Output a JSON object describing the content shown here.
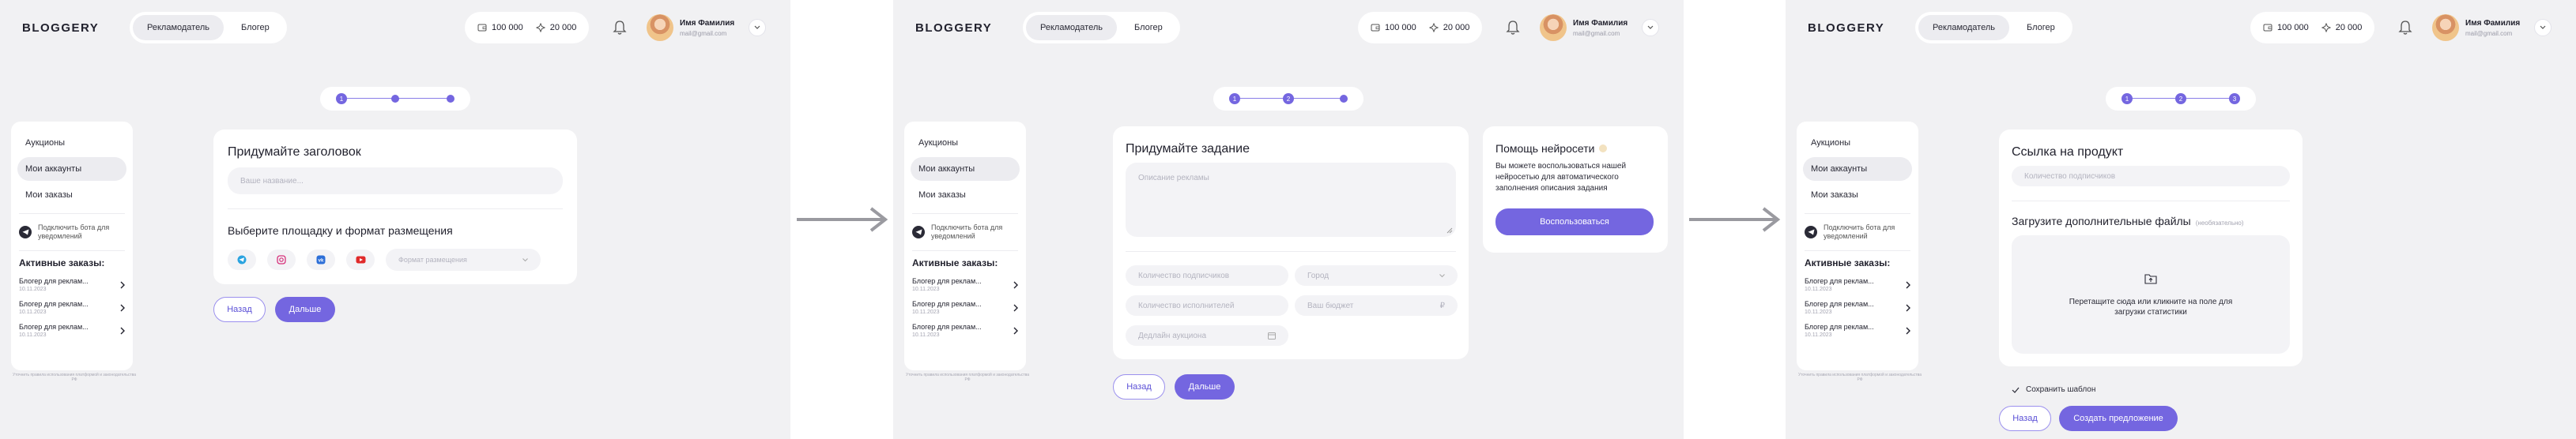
{
  "header": {
    "logo": "BLOGGERY",
    "roles": [
      "Рекламодатель",
      "Блогер"
    ],
    "balance_1": "100 000",
    "balance_2": "20 000",
    "user_name": "Имя Фамилия",
    "user_email": "mail@gmail.com"
  },
  "stepper": {
    "labels": [
      "1",
      "2",
      "3"
    ]
  },
  "sidebar": {
    "items": [
      "Аукционы",
      "Мои аккаунты",
      "Мои заказы"
    ],
    "telegram": "Подключить бота для уведомлений",
    "orders_title": "Активные заказы:",
    "orders": [
      {
        "name": "Блогер для реклам...",
        "date": "10.11.2023"
      },
      {
        "name": "Блогер для реклам...",
        "date": "10.11.2023"
      },
      {
        "name": "Блогер для реклам...",
        "date": "10.11.2023"
      }
    ],
    "legal": "Уточнить правила использования платформой и законодательства РФ"
  },
  "step1": {
    "title": "Придумайте заголовок",
    "title_placeholder": "Ваше название...",
    "platform_title": "Выберите площадку и формат размещения",
    "format_placeholder": "Формат размещения"
  },
  "step2": {
    "title": "Придумайте задание",
    "description_placeholder": "Описание рекламы",
    "subscribers_placeholder": "Количество подписчиков",
    "city_placeholder": "Город",
    "performers_placeholder": "Количество исполнителей",
    "budget_placeholder": "Ваш бюджет",
    "budget_currency": "₽",
    "deadline_placeholder": "Дедлайн аукциона",
    "ai_title": "Помощь нейросети",
    "ai_text": "Вы можете воспользоваться нашей нейросетью для автоматического заполнения описания задания",
    "ai_button": "Воспользоваться"
  },
  "step3": {
    "title": "Ссылка на продукт",
    "link_placeholder": "Количество подписчиков",
    "files_title": "Загрузите дополнительные файлы",
    "files_optional": "(необязательно)",
    "drop_text": "Перетащите сюда или кликните на поле для загрузки статистики",
    "save_template": "Сохранить шаблон",
    "create_button": "Создать предложение"
  },
  "buttons": {
    "back": "Назад",
    "next": "Дальше"
  },
  "colors": {
    "accent": "#7466e0",
    "background": "#f1f1f3",
    "card": "#ffffff"
  }
}
